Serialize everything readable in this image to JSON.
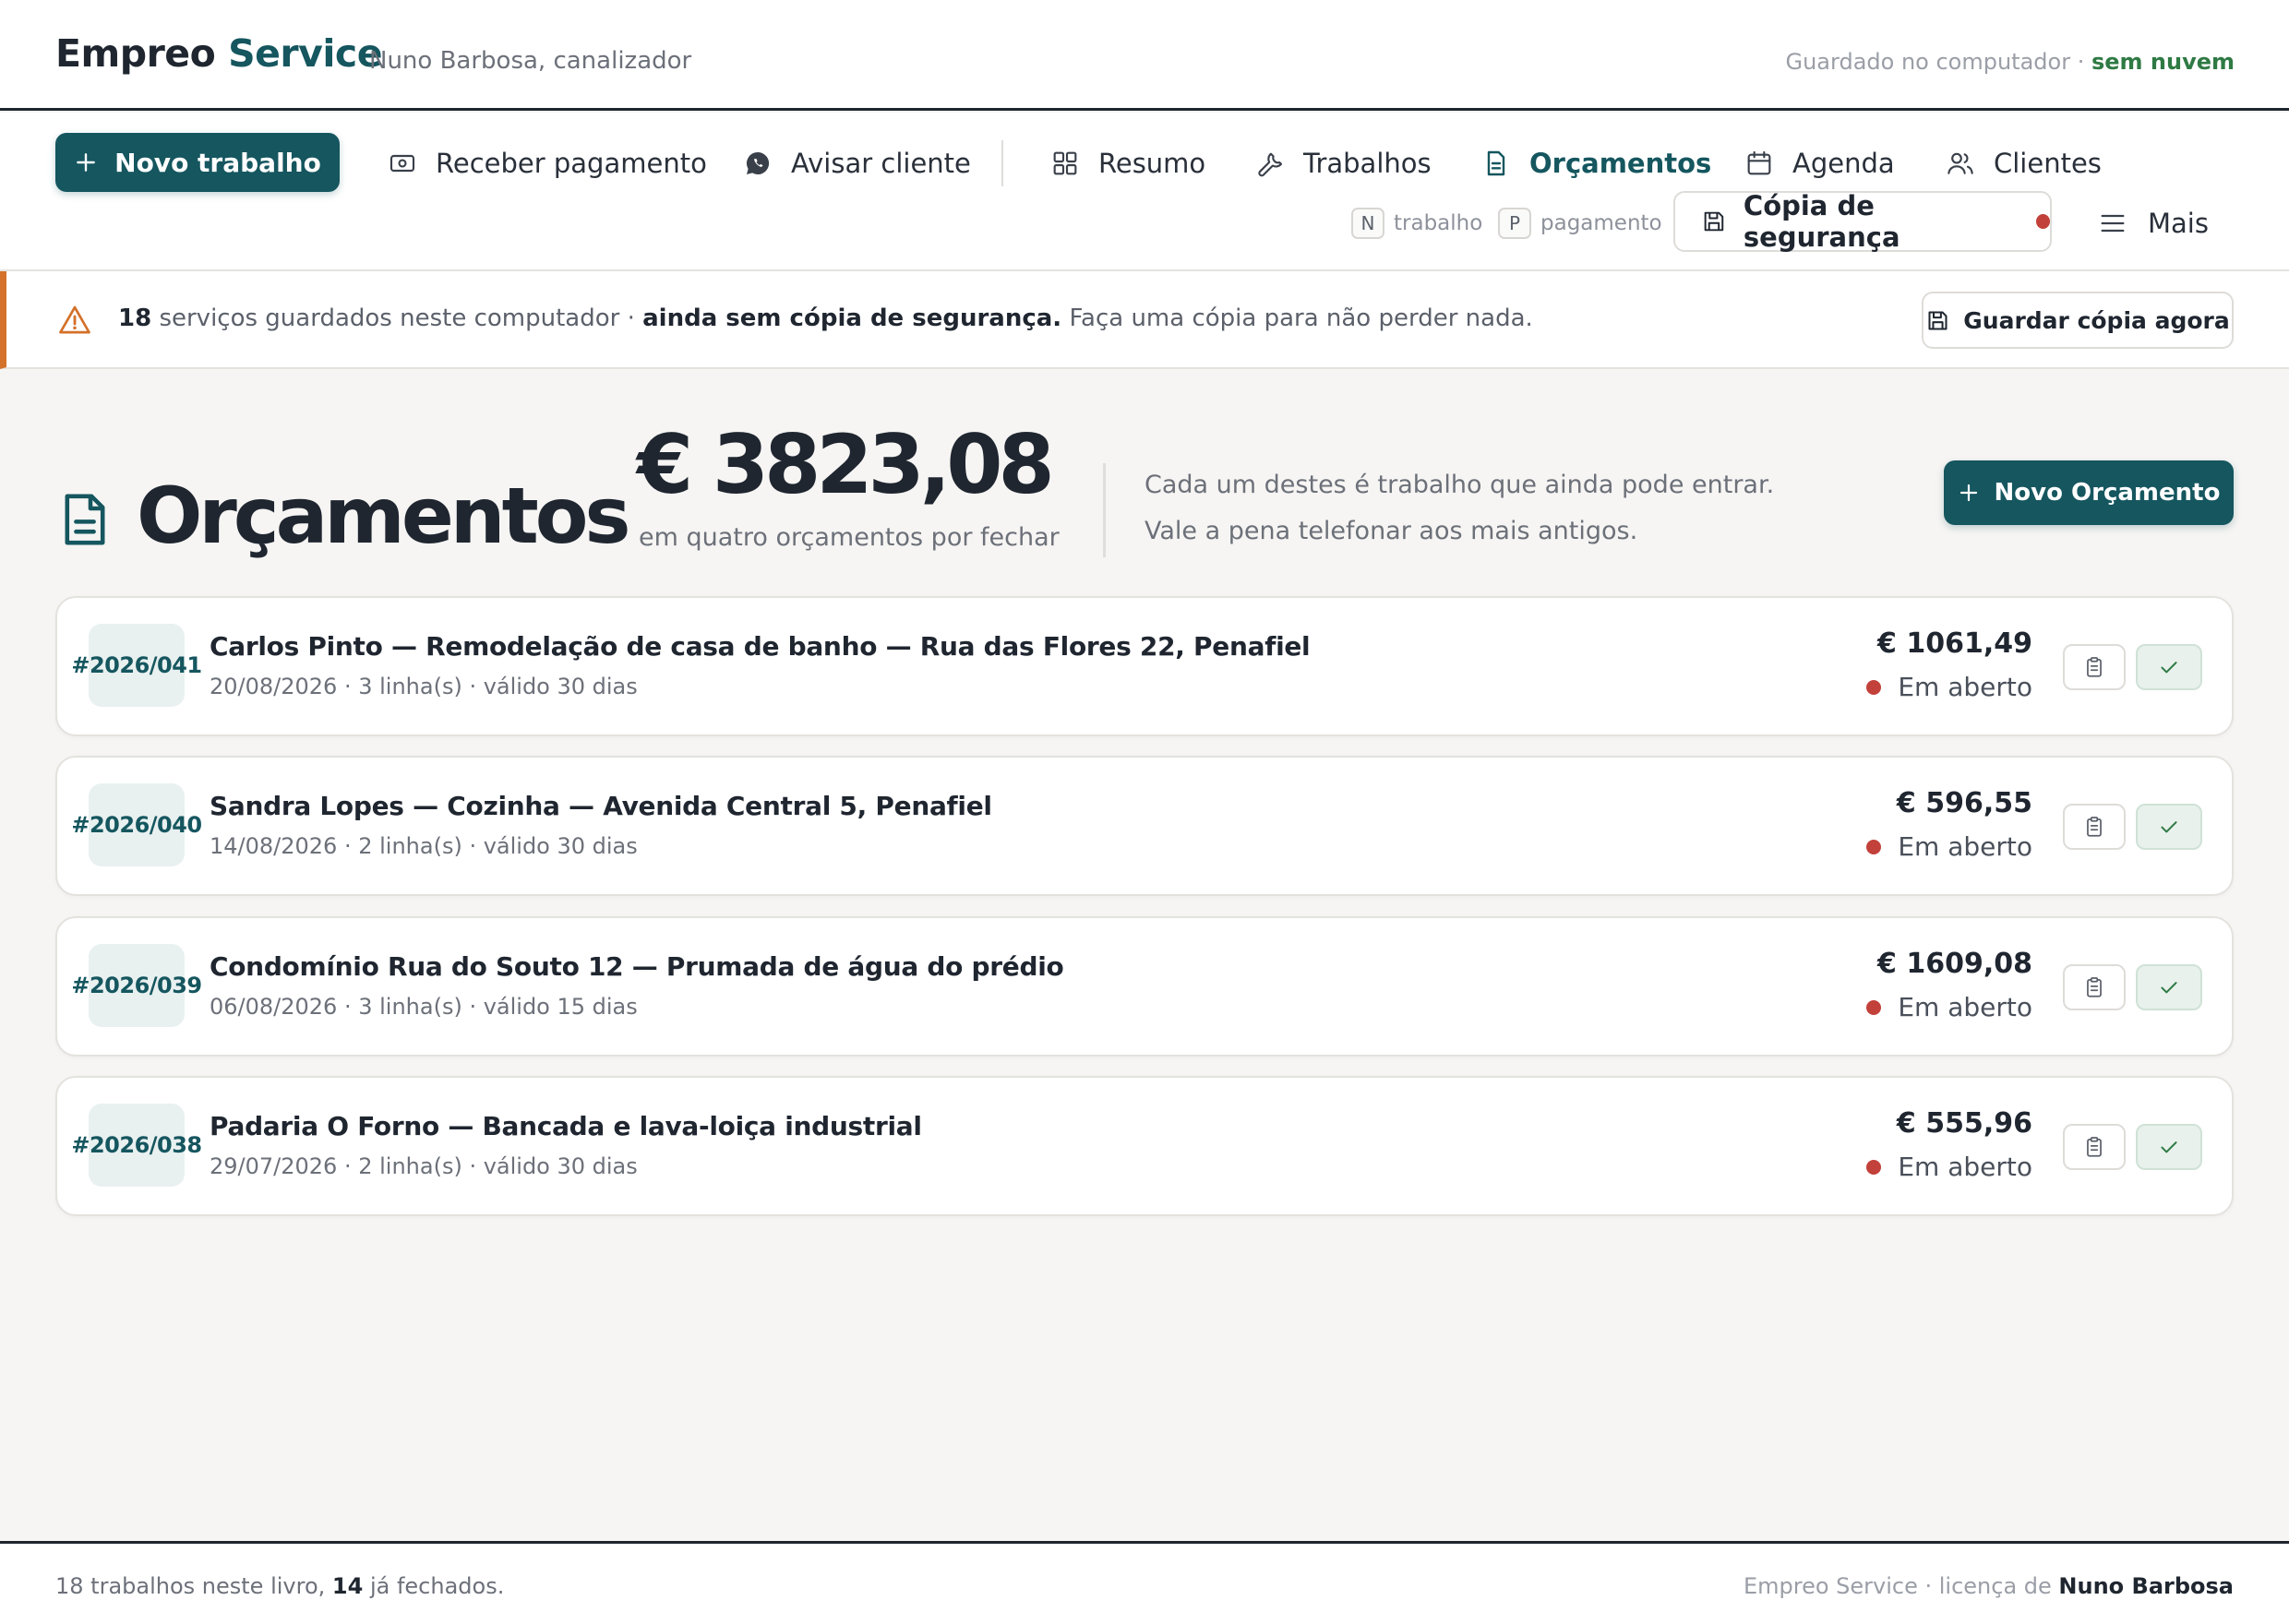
{
  "header": {
    "brand_part1": "Empreo",
    "brand_part2": "Service",
    "owner": "Nuno Barbosa, canalizador",
    "storage_text": "Guardado no computador · ",
    "storage_status": "sem nuvem"
  },
  "nav": {
    "new_job": "Novo trabalho",
    "receive_payment": "Receber pagamento",
    "notify_client": "Avisar cliente",
    "summary": "Resumo",
    "jobs": "Trabalhos",
    "quotes": "Orçamentos",
    "agenda": "Agenda",
    "clients": "Clientes",
    "shortcut_n_key": "N",
    "shortcut_n_label": "trabalho",
    "shortcut_p_key": "P",
    "shortcut_p_label": "pagamento",
    "backup": "Cópia de segurança",
    "more": "Mais"
  },
  "alert": {
    "count": "18",
    "text1": " serviços guardados neste computador · ",
    "bold": "ainda sem cópia de segurança.",
    "text2": " Faça uma cópia para não perder nada.",
    "button": "Guardar cópia agora"
  },
  "page": {
    "title": "Orçamentos",
    "total": "€ 3823,08",
    "total_sub": "em quatro orçamentos por fechar",
    "hint_line1": "Cada um destes é trabalho que ainda pode entrar.",
    "hint_line2": "Vale a pena telefonar aos mais antigos.",
    "new_quote": "Novo Orçamento"
  },
  "quotes": [
    {
      "number": "#2026/041",
      "title": "Carlos Pinto — Remodelação de casa de banho — Rua das Flores 22, Penafiel",
      "meta": "20/08/2026 · 3 linha(s) · válido 30 dias",
      "amount": "€ 1061,49",
      "status": "Em aberto"
    },
    {
      "number": "#2026/040",
      "title": "Sandra Lopes — Cozinha — Avenida Central 5, Penafiel",
      "meta": "14/08/2026 · 2 linha(s) · válido 30 dias",
      "amount": "€ 596,55",
      "status": "Em aberto"
    },
    {
      "number": "#2026/039",
      "title": "Condomínio Rua do Souto 12 — Prumada de água do prédio",
      "meta": "06/08/2026 · 3 linha(s) · válido 15 dias",
      "amount": "€ 1609,08",
      "status": "Em aberto"
    },
    {
      "number": "#2026/038",
      "title": "Padaria O Forno — Bancada e lava-loiça industrial",
      "meta": "29/07/2026 · 2 linha(s) · válido 30 dias",
      "amount": "€ 555,96",
      "status": "Em aberto"
    }
  ],
  "footer": {
    "left1": "18 trabalhos neste livro, ",
    "left_bold": "14",
    "left2": " já fechados.",
    "right1": "Empreo Service · licença de ",
    "right_bold": "Nuno Barbosa"
  },
  "colors": {
    "accent": "#15565f",
    "status_open": "#c2413a",
    "warning": "#d4712a",
    "cloud_status": "#2f7a44"
  }
}
